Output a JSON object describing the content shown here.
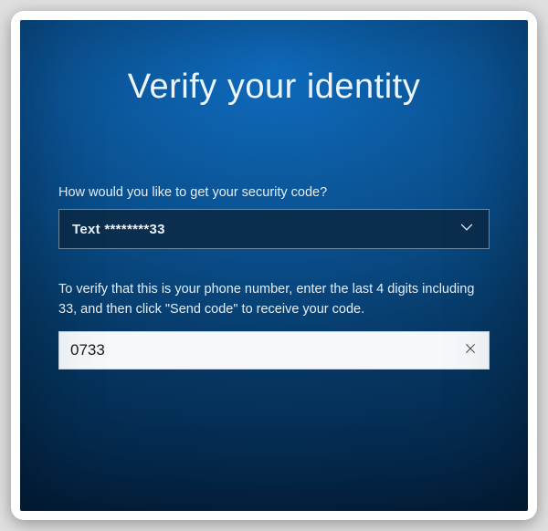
{
  "title": "Verify your identity",
  "prompt": "How would you like to get your security code?",
  "method": {
    "selected_label": "Text ********33"
  },
  "verify_instruction": "To verify that this is your phone number, enter the last 4 digits including 33, and then click \"Send code\" to receive your code.",
  "digits_input": {
    "value": "0733",
    "placeholder": ""
  }
}
